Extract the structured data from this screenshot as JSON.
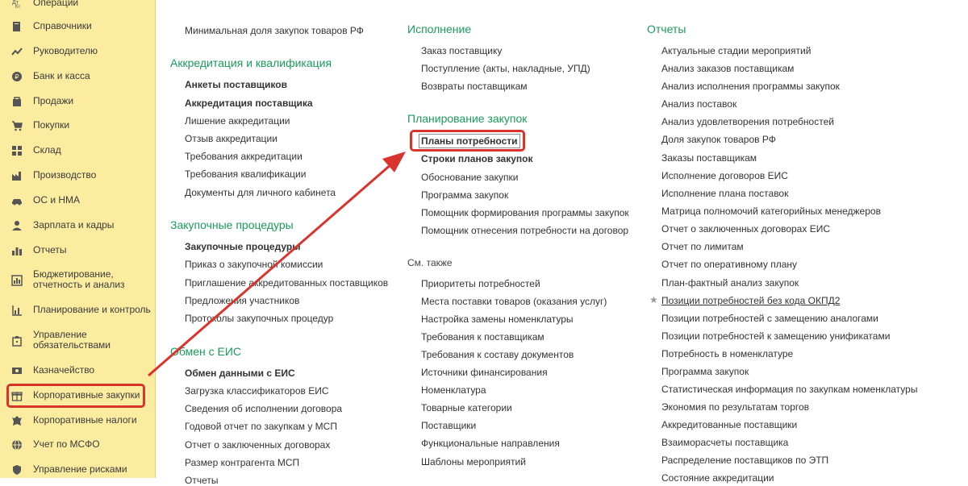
{
  "sidebar": {
    "items": [
      {
        "label": "Операции",
        "icon": "operations-icon"
      },
      {
        "label": "Справочники",
        "icon": "catalogs-icon"
      },
      {
        "label": "Руководителю",
        "icon": "chart-trend-icon"
      },
      {
        "label": "Банк и касса",
        "icon": "bank-icon"
      },
      {
        "label": "Продажи",
        "icon": "bag-icon"
      },
      {
        "label": "Покупки",
        "icon": "cart-icon"
      },
      {
        "label": "Склад",
        "icon": "warehouse-icon"
      },
      {
        "label": "Производство",
        "icon": "factory-icon"
      },
      {
        "label": "ОС и НМА",
        "icon": "car-icon"
      },
      {
        "label": "Зарплата и кадры",
        "icon": "person-icon"
      },
      {
        "label": "Отчеты",
        "icon": "bar-chart-icon"
      },
      {
        "label": "Бюджетирование, отчетность и анализ",
        "icon": "budget-icon"
      },
      {
        "label": "Планирование и контроль",
        "icon": "planning-icon"
      },
      {
        "label": "Управление обязательствами",
        "icon": "obligations-icon"
      },
      {
        "label": "Казначейство",
        "icon": "treasury-icon"
      },
      {
        "label": "Корпоративные закупки",
        "icon": "gift-icon"
      },
      {
        "label": "Корпоративные налоги",
        "icon": "emblem-icon"
      },
      {
        "label": "Учет по МСФО",
        "icon": "globe-icon"
      },
      {
        "label": "Управление рисками",
        "icon": "shield-icon"
      }
    ]
  },
  "col1": {
    "top_item": "Минимальная доля закупок товаров РФ",
    "sections": [
      {
        "title": "Аккредитация и квалификация",
        "items": [
          "Анкеты поставщиков",
          "Аккредитация поставщика",
          "Лишение аккредитации",
          "Отзыв аккредитации",
          "Требования аккредитации",
          "Требования квалификации",
          "Документы для личного кабинета"
        ]
      },
      {
        "title": "Закупочные процедуры",
        "items": [
          "Закупочные процедуры",
          "Приказ о закупочной комиссии",
          "Приглашение аккредитованных поставщиков",
          "Предложения участников",
          "Протоколы закупочных процедур"
        ]
      },
      {
        "title": "Обмен с ЕИС",
        "items": [
          "Обмен данными с ЕИС",
          "Загрузка классификаторов ЕИС",
          "Сведения об исполнении договора",
          "Годовой отчет по закупкам у МСП",
          "Отчет о заключенных договорах",
          "Размер контрагента МСП",
          "Отчеты"
        ]
      }
    ]
  },
  "col2": {
    "sections": [
      {
        "title": "Исполнение",
        "items": [
          "Заказ поставщику",
          "Поступление (акты, накладные, УПД)",
          "Возвраты поставщикам"
        ]
      },
      {
        "title": "Планирование закупок",
        "items": [
          "Планы потребности",
          "Строки планов закупок",
          "Обоснование закупки",
          "Программа закупок",
          "Помощник формирования программы закупок",
          "Помощник отнесения потребности на договор"
        ]
      },
      {
        "title": "См. также",
        "items": [
          "Приоритеты потребностей",
          "Места поставки товаров (оказания услуг)",
          "Настройка замены номенклатуры",
          "Требования к поставщикам",
          "Требования к составу документов",
          "Источники финансирования",
          "Номенклатура",
          "Товарные категории",
          "Поставщики",
          "Функциональные направления",
          "Шаблоны мероприятий"
        ]
      }
    ]
  },
  "col3": {
    "title": "Отчеты",
    "items": [
      "Актуальные стадии мероприятий",
      "Анализ заказов поставщикам",
      "Анализ исполнения программы закупок",
      "Анализ поставок",
      "Анализ удовлетворения потребностей",
      "Доля закупок товаров РФ",
      "Заказы поставщикам",
      "Исполнение договоров ЕИС",
      "Исполнение плана поставок",
      "Матрица полномочий категорийных менеджеров",
      "Отчет о заключенных договорах ЕИС",
      "Отчет по лимитам",
      "Отчет по оперативному плану",
      "План-фактный анализ закупок",
      "Позиции потребностей без кода ОКПД2",
      "Позиции потребностей с замещению аналогами",
      "Позиции потребностей к замещению унификатами",
      "Потребность в номенклатуре",
      "Программа закупок",
      "Статистическая информация по закупкам номенклатуры",
      "Экономия по результатам торгов",
      "Аккредитованные поставщики",
      "Взаиморасчеты поставщика",
      "Распределение поставщиков по ЭТП",
      "Состояние аккредитации"
    ]
  },
  "colors": {
    "sidebar_bg": "#fbeca0",
    "section_header": "#1c9a5b",
    "highlight": "#d9342b",
    "text": "#333333"
  }
}
